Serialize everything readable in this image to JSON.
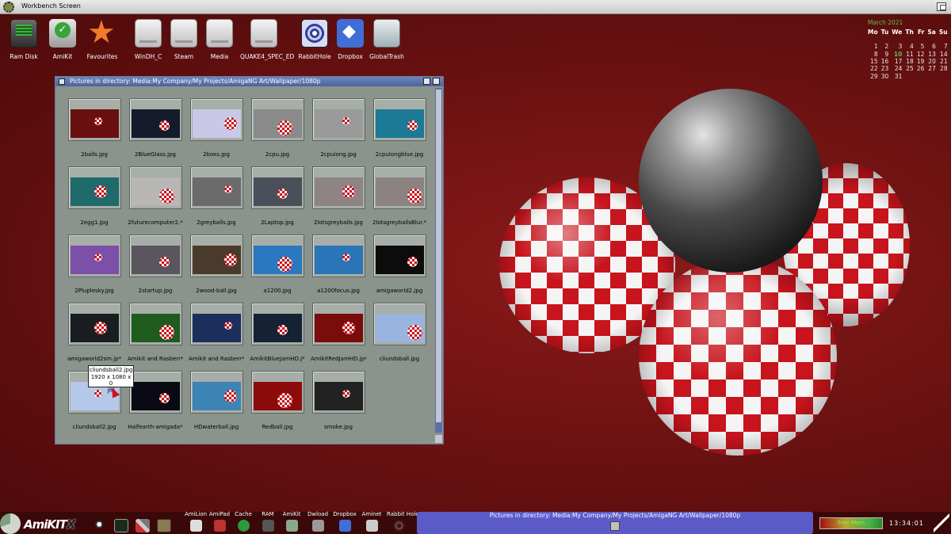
{
  "screen": {
    "title": "Workbench Screen"
  },
  "desktop_icons": [
    {
      "label": "Ram Disk",
      "icon": "ram-disk-icon"
    },
    {
      "label": "AmiKit",
      "icon": "amikit-drive-icon"
    },
    {
      "label": "Favourites",
      "icon": "star-icon"
    },
    {
      "label": "WinDH_C",
      "icon": "hard-drive-icon"
    },
    {
      "label": "Steam",
      "icon": "hard-drive-icon"
    },
    {
      "label": "Media",
      "icon": "hard-drive-icon"
    },
    {
      "label": "QUAKE4_SPEC_ED",
      "icon": "hard-drive-icon"
    },
    {
      "label": "RabbitHole",
      "icon": "rabbit-hole-icon"
    },
    {
      "label": "Dropbox",
      "icon": "dropbox-icon"
    },
    {
      "label": "GlobalTrash",
      "icon": "trash-icon"
    }
  ],
  "calendar": {
    "title": "March 2021",
    "days": [
      "Mo",
      "Tu",
      "We",
      "Th",
      "Fr",
      "Sa",
      "Su"
    ],
    "weeks": [
      [
        "",
        "",
        "",
        "",
        "",
        "",
        ""
      ],
      [
        "1",
        "2",
        "3",
        "4",
        "5",
        "6",
        "7"
      ],
      [
        "8",
        "9",
        "10",
        "11",
        "12",
        "13",
        "14"
      ],
      [
        "15",
        "16",
        "17",
        "18",
        "19",
        "20",
        "21"
      ],
      [
        "22",
        "23",
        "24",
        "25",
        "26",
        "27",
        "28"
      ],
      [
        "29",
        "30",
        "31",
        "",
        "",
        "",
        ""
      ]
    ],
    "today": "10"
  },
  "window": {
    "title": "Pictures in directory: Media:My Company/My Projects/AmigaNG Art/Wallpaper/1080p",
    "files": [
      "2balls.jpg",
      "2BlueGlass.jpg",
      "2boxs.jpg",
      "2cpu.jpg",
      "2cpulong.jpg",
      "2cpulongblue.jpg",
      "2egg1.jpg",
      "2futurecomputer2.*",
      "2greyballs.jpg",
      "2Laptop.jpg",
      "2lotsgreyballs.jpg",
      "2lotsgreyballsBlur.*",
      "2Pluplesky.jpg",
      "2startup.jpg",
      "2wood-ball.jpg",
      "a1200.jpg",
      "a1200focus.jpg",
      "amigaworld2.jpg",
      "amigaworld2sm.jp*",
      "Amikit and Rasberr*",
      "Amikit and Rasberr*",
      "AmikitBlueJamHD.j*",
      "AmikitRedJamHD.jp*",
      "cliundsball.jpg",
      "cliundsball2.jpg",
      "Halfearth-amigada*",
      "HDwaterball.jpg",
      "Redball.jpg",
      "smoke.jpg"
    ],
    "thumb_colors": [
      "#6b1010",
      "#141c2c",
      "#c9c8e6",
      "#8a8a8a",
      "#9a9a9a",
      "#1c7a96",
      "#1f6a6a",
      "#b9b6b6",
      "#6b6b6b",
      "#4b4f5a",
      "#8e8484",
      "#8c8282",
      "#7c4fa8",
      "#5b5560",
      "#4a3a2c",
      "#2a78c0",
      "#2a74b8",
      "#0c0c0c",
      "#1a1d22",
      "#1f5a1f",
      "#1c2e5c",
      "#142234",
      "#7a0c0c",
      "#9ab4e0",
      "#b4c8ea",
      "#0a0a14",
      "#3c84b4",
      "#8c0c0c",
      "#222222"
    ]
  },
  "tooltip": {
    "line1": "cliundsball2.jpg",
    "line2": "1920 x 1080 x 0",
    "line3": "jfif"
  },
  "taskbar": {
    "logo": "AmiKIT",
    "logo_x": "X",
    "launchers": [
      "AmiLion",
      "AmiPad",
      "Cache",
      "RAM",
      "AmiKit",
      "Dwload",
      "Dropbox",
      "Aminet",
      "Rabbit Hole"
    ],
    "task_title": "Pictures in directory: Media:My Company/My Projects/AmigaNG Art/Wallpaper/1080p",
    "memory_label": "Free Mem",
    "clock": "13:34:01"
  }
}
